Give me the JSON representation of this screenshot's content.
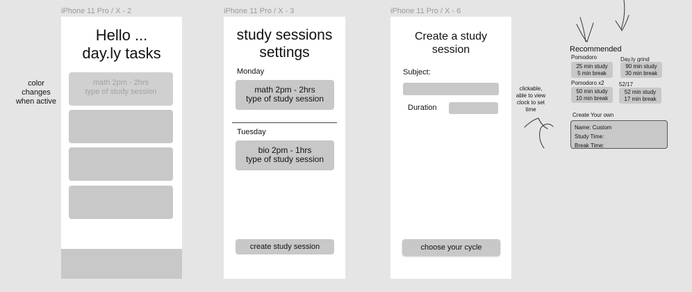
{
  "frames": {
    "f1": {
      "label": "iPhone 11 Pro / X - 2",
      "title_line1": "Hello ...",
      "title_line2": "day.ly  tasks",
      "card1_line1": "math 2pm - 2hrs",
      "card1_line2": "type of study session"
    },
    "f2": {
      "label": "iPhone 11 Pro / X - 3",
      "title_line1": "study sessions",
      "title_line2": "settings",
      "day1": "Monday",
      "session1_line1": "math 2pm - 2hrs",
      "session1_line2": "type of study session",
      "day2": "Tuesday",
      "session2_line1": "bio 2pm - 1hrs",
      "session2_line2": "type of study session",
      "button": "create study session"
    },
    "f3": {
      "label": "iPhone 11 Pro / X - 6",
      "title_line1": "Create a study",
      "title_line2": "session",
      "subject_label": "Subject:",
      "duration_label": "Duration",
      "button": "choose your cycle"
    }
  },
  "annotations": {
    "left_line1": "color",
    "left_line2": "changes",
    "left_line3": "when active",
    "clickable_line1": "clickable,",
    "clickable_line2": "able to view",
    "clickable_line3": "clock to set",
    "clickable_line4": "time"
  },
  "recommended": {
    "heading": "Recommended",
    "pomodoro": {
      "label": "Pomodoro",
      "line1": "25 min study",
      "line2": "5 min break"
    },
    "daily_grind": {
      "label": "Day.ly grind",
      "line1": "90 min study",
      "line2": "30 min break"
    },
    "pomodoro_x2": {
      "label": "Pomodoro x2",
      "line1": "50 min study",
      "line2": "10 min break"
    },
    "r52_17": {
      "label": "52/17",
      "line1": "52 min study",
      "line2": "17 min break"
    },
    "custom_heading": "Create Your own",
    "custom_name": "Name:  Custom",
    "custom_study": "Study Time:",
    "custom_break": "Break Time:"
  }
}
